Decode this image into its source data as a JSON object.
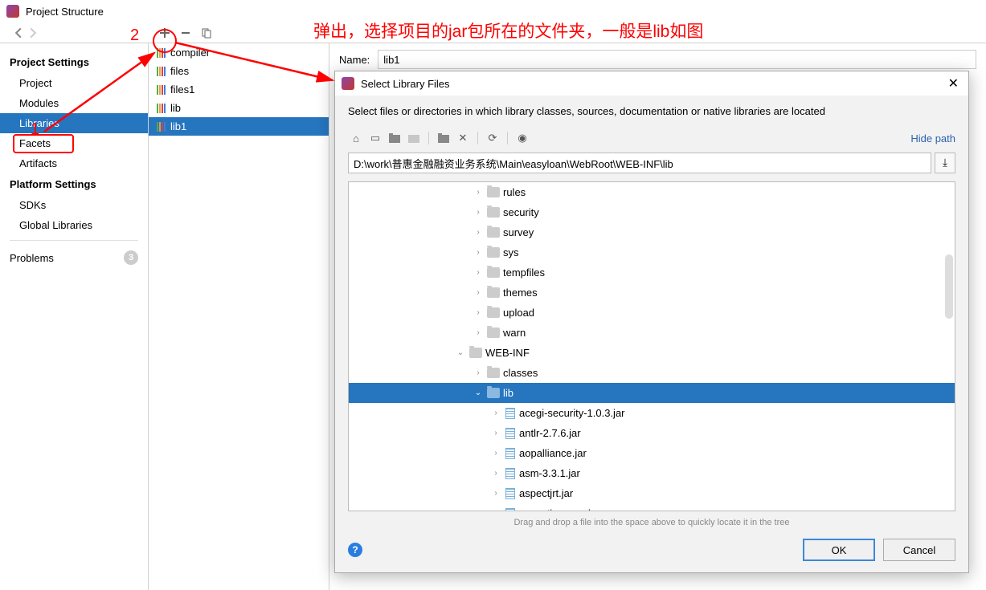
{
  "window": {
    "title": "Project Structure"
  },
  "annotations": {
    "main_text": "弹出，选择项目的jar包所在的文件夹，一般是lib如图",
    "step1": "1",
    "step2": "2"
  },
  "sidebar": {
    "project_heading": "Project Settings",
    "project_items": [
      "Project",
      "Modules",
      "Libraries",
      "Facets",
      "Artifacts"
    ],
    "selected": "Libraries",
    "platform_heading": "Platform Settings",
    "platform_items": [
      "SDKs",
      "Global Libraries"
    ],
    "problems_label": "Problems",
    "problems_count": "3"
  },
  "libraries": {
    "items": [
      "compiler",
      "files",
      "files1",
      "lib",
      "lib1"
    ],
    "selected": "lib1"
  },
  "detail": {
    "name_label": "Name:",
    "name_value": "lib1"
  },
  "dialog": {
    "title": "Select Library Files",
    "description": "Select files or directories in which library classes, sources, documentation or native libraries are located",
    "hide_path": "Hide path",
    "path": "D:\\work\\普惠金融融资业务系统\\Main\\easyloan\\WebRoot\\WEB-INF\\lib",
    "tree": [
      {
        "name": "rules",
        "type": "folder",
        "indent": 7,
        "expand": "right"
      },
      {
        "name": "security",
        "type": "folder",
        "indent": 7,
        "expand": "right"
      },
      {
        "name": "survey",
        "type": "folder",
        "indent": 7,
        "expand": "right"
      },
      {
        "name": "sys",
        "type": "folder",
        "indent": 7,
        "expand": "right"
      },
      {
        "name": "tempfiles",
        "type": "folder",
        "indent": 7,
        "expand": "right"
      },
      {
        "name": "themes",
        "type": "folder",
        "indent": 7,
        "expand": "right"
      },
      {
        "name": "upload",
        "type": "folder",
        "indent": 7,
        "expand": "right"
      },
      {
        "name": "warn",
        "type": "folder",
        "indent": 7,
        "expand": "right"
      },
      {
        "name": "WEB-INF",
        "type": "folder",
        "indent": 6,
        "expand": "down"
      },
      {
        "name": "classes",
        "type": "folder",
        "indent": 7,
        "expand": "right"
      },
      {
        "name": "lib",
        "type": "folder",
        "indent": 7,
        "expand": "down",
        "selected": true
      },
      {
        "name": "acegi-security-1.0.3.jar",
        "type": "jar",
        "indent": 8,
        "expand": "right"
      },
      {
        "name": "antlr-2.7.6.jar",
        "type": "jar",
        "indent": 8,
        "expand": "right"
      },
      {
        "name": "aopalliance.jar",
        "type": "jar",
        "indent": 8,
        "expand": "right"
      },
      {
        "name": "asm-3.3.1.jar",
        "type": "jar",
        "indent": 8,
        "expand": "right"
      },
      {
        "name": "aspectjrt.jar",
        "type": "jar",
        "indent": 8,
        "expand": "right"
      },
      {
        "name": "aspectjweaver.jar",
        "type": "jar",
        "indent": 8,
        "expand": "right"
      }
    ],
    "drag_hint": "Drag and drop a file into the space above to quickly locate it in the tree",
    "ok": "OK",
    "cancel": "Cancel"
  }
}
